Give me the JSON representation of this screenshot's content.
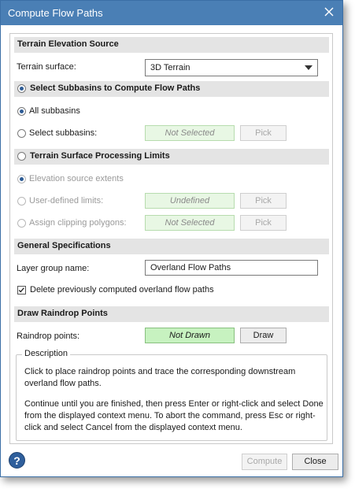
{
  "window": {
    "title": "Compute Flow Paths"
  },
  "sections": {
    "terrain": "Terrain Elevation Source",
    "subbasins": "Select Subbasins to Compute Flow Paths",
    "limits": "Terrain Surface Processing Limits",
    "general": "General Specifications",
    "raindrop": "Draw Raindrop Points"
  },
  "terrain": {
    "label": "Terrain surface:",
    "selected": "3D Terrain"
  },
  "subbasins": {
    "all_label": "All subbasins",
    "select_label": "Select subbasins:",
    "status": "Not Selected",
    "pick": "Pick"
  },
  "limits": {
    "extents_label": "Elevation source extents",
    "user_label": "User-defined limits:",
    "user_status": "Undefined",
    "clip_label": "Assign clipping polygons:",
    "clip_status": "Not Selected",
    "pick": "Pick"
  },
  "general": {
    "layer_label": "Layer group name:",
    "layer_value": "Overland Flow Paths",
    "delete_label": "Delete previously computed overland flow paths"
  },
  "raindrop": {
    "label": "Raindrop points:",
    "status": "Not Drawn",
    "draw": "Draw"
  },
  "description": {
    "legend": "Description",
    "p1": "Click to place raindrop points and trace the corresponding downstream overland flow paths.",
    "p2": "Continue until you are finished, then press Enter or right-click and select Done from the displayed context menu. To abort the command, press Esc or right-click and select Cancel from the displayed context menu."
  },
  "footer": {
    "help": "?",
    "compute": "Compute",
    "close": "Close"
  },
  "icons": {
    "close": "close-icon",
    "help": "help-icon",
    "dropdown": "chevron-down-icon",
    "check": "check-icon"
  },
  "colors": {
    "titlebar": "#4a7fb5",
    "accent": "#2c5b95",
    "status_green": "#c7f2c0"
  }
}
